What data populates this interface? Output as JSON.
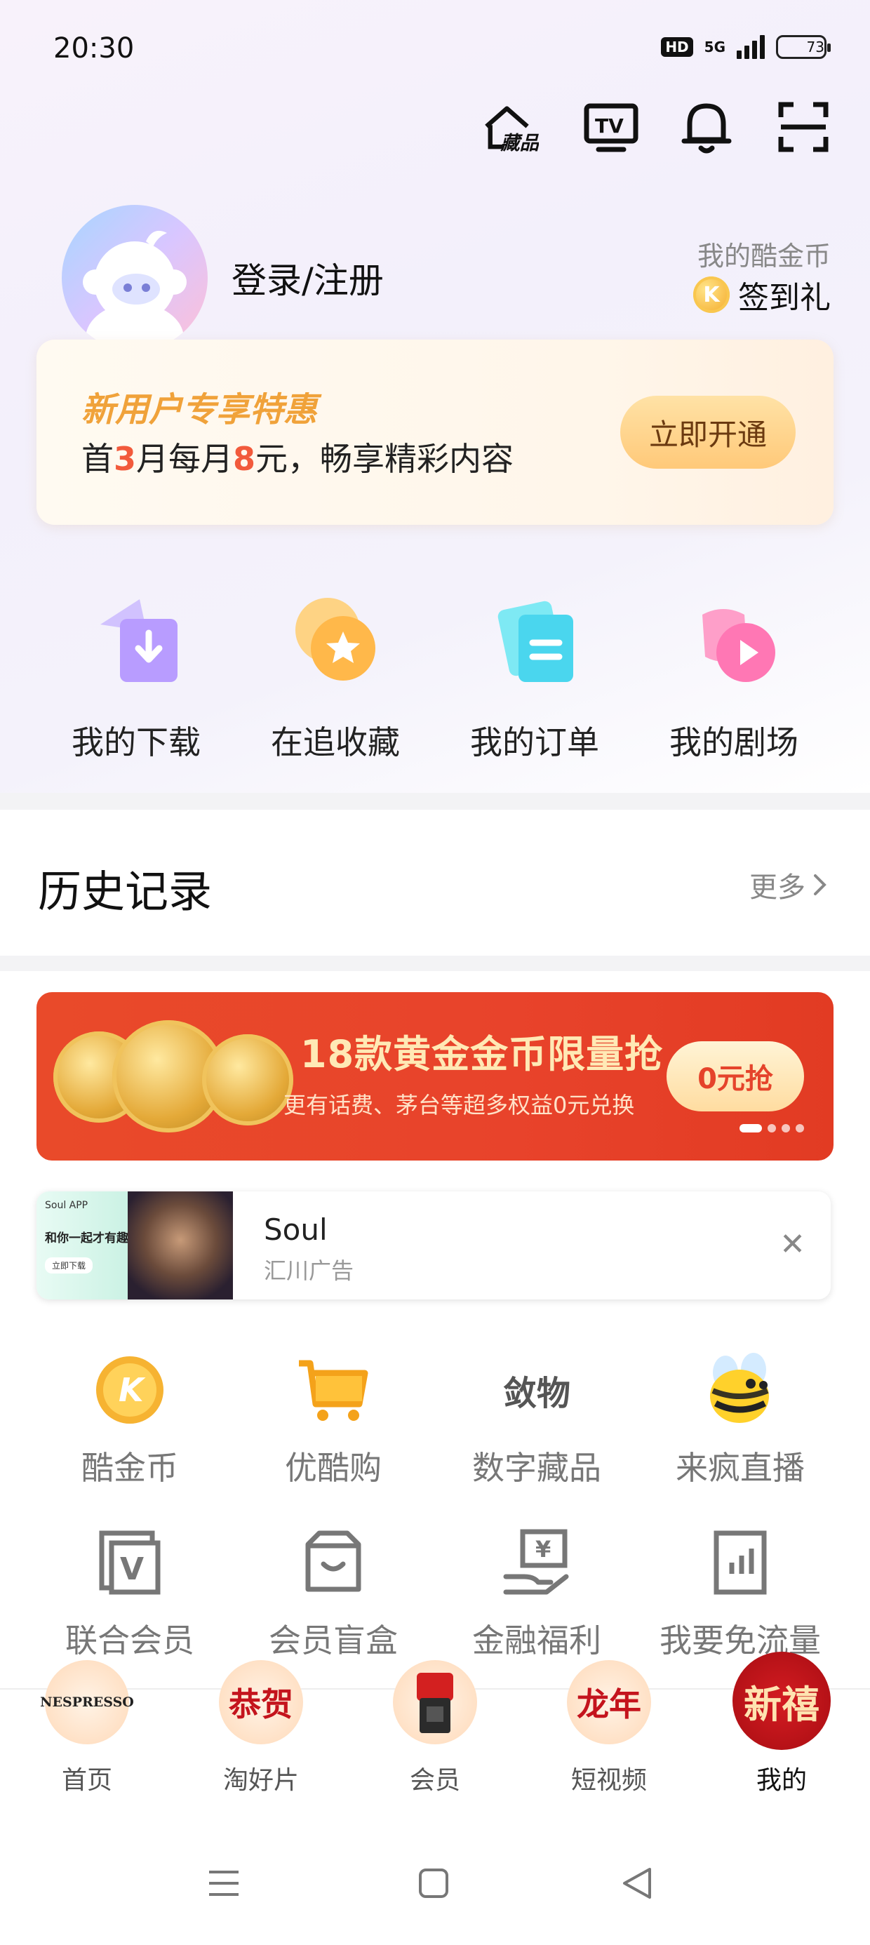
{
  "status_bar": {
    "time": "20:30",
    "hd": "HD",
    "network": "5G",
    "battery": "73",
    "battery_level_percent": 73
  },
  "top_actions": [
    "collection-icon",
    "tv-icon",
    "bell-icon",
    "scan-icon"
  ],
  "top_actions_text": {
    "collection": "藏品",
    "tv": "TV"
  },
  "profile": {
    "login_text": "登录/注册",
    "coin_label": "我的酷金币",
    "signin_text": "签到礼",
    "coin_glyph": "K"
  },
  "promo": {
    "title": "新用户专享特惠",
    "sub_parts": [
      "首",
      "3",
      "月每月",
      "8",
      "元，畅享精彩内容"
    ],
    "button": "立即开通"
  },
  "quick_actions": [
    {
      "label": "我的下载",
      "icon": "download-icon"
    },
    {
      "label": "在追收藏",
      "icon": "star-icon"
    },
    {
      "label": "我的订单",
      "icon": "order-icon"
    },
    {
      "label": "我的剧场",
      "icon": "play-icon"
    }
  ],
  "history": {
    "title": "历史记录",
    "more": "更多"
  },
  "banner": {
    "title": "18款黄金金币限量抢",
    "subtitle": "更有话费、茅台等超多权益0元兑换",
    "button": "0元抢",
    "pages": 4,
    "current_page": 1
  },
  "ad": {
    "name": "Soul",
    "tag": "汇川广告",
    "thumb_brand": "Soul APP",
    "thumb_text": "和你一起才有趣",
    "thumb_btn": "立即下载"
  },
  "services": [
    {
      "label": "酷金币",
      "icon": "coin-icon"
    },
    {
      "label": "优酷购",
      "icon": "cart-icon"
    },
    {
      "label": "数字藏品",
      "icon": "digital-collection-icon",
      "glyph": "敛物"
    },
    {
      "label": "来疯直播",
      "icon": "bee-icon"
    },
    {
      "label": "联合会员",
      "icon": "joint-vip-icon",
      "glyph": "V"
    },
    {
      "label": "会员盲盒",
      "icon": "blind-box-icon"
    },
    {
      "label": "金融福利",
      "icon": "finance-icon",
      "glyph": "¥"
    },
    {
      "label": "我要免流量",
      "icon": "data-free-icon"
    }
  ],
  "tabs": [
    {
      "label": "首页",
      "glyph": "NESPRESSO"
    },
    {
      "label": "淘好片",
      "glyph": "恭贺"
    },
    {
      "label": "会员",
      "glyph": ""
    },
    {
      "label": "短视频",
      "glyph": "龙年"
    },
    {
      "label": "我的",
      "glyph": "新禧",
      "active": true
    }
  ],
  "colors": {
    "accent_orange": "#f0a23a",
    "highlight_red": "#f25a3c",
    "banner_red": "#e8432b",
    "tab_red": "#c4141d"
  }
}
